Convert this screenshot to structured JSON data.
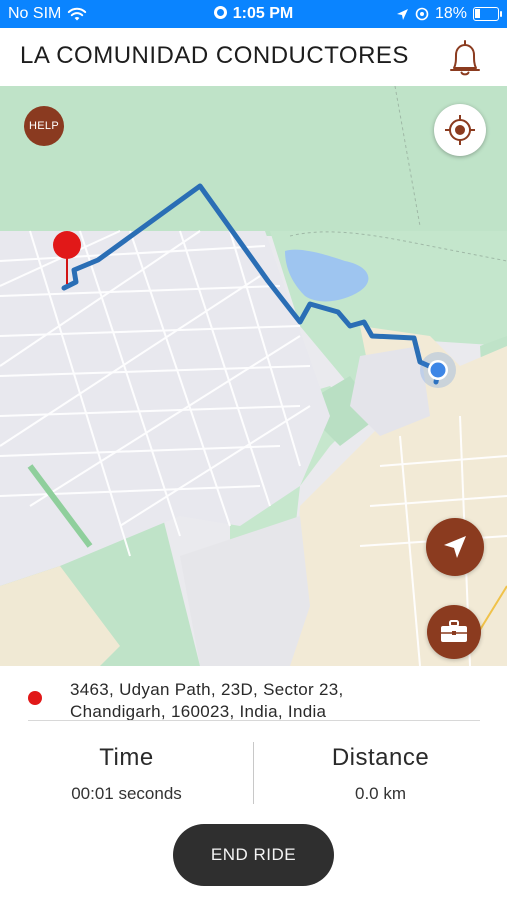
{
  "status_bar": {
    "carrier": "No SIM",
    "time": "1:05 PM",
    "battery": "18%"
  },
  "header": {
    "title": "LA COMUNIDAD CONDUCTORES",
    "bell_icon": "bell-icon"
  },
  "map": {
    "help_label": "HELP",
    "route_color": "#2a6eb5",
    "accent_color": "#8b3b1f",
    "destination_pin_color": "#e11818",
    "current_location_color": "#3d86e6"
  },
  "address": {
    "line1": "3463,  Udyan Path, 23D, Sector 23,",
    "line2": "Chandigarh, 160023, India, India"
  },
  "stats": {
    "time_label": "Time",
    "time_value": "00:01 seconds",
    "distance_label": "Distance",
    "distance_value": "0.0 km"
  },
  "actions": {
    "end_ride": "END RIDE"
  }
}
